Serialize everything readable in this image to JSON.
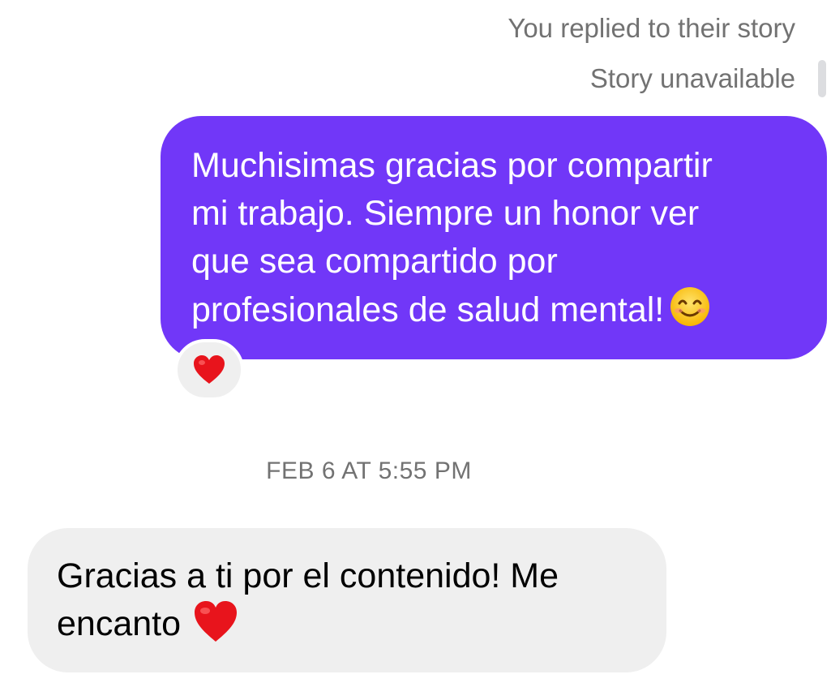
{
  "story_reply": {
    "label": "You replied to their story",
    "story_status": "Story unavailable"
  },
  "sent_message": {
    "lines": [
      "Muchisimas gracias por compartir",
      "mi trabajo. Siempre un honor ver",
      "que sea compartido por",
      "profesionales de salud mental!"
    ],
    "trailing_emoji": "smiling-face-emoji",
    "bubble_color": "#7137f8",
    "reaction": "red-heart-emoji"
  },
  "timestamp": "FEB 6 AT 5:55 PM",
  "received_message": {
    "lines": [
      "Gracias a ti por el contenido! Me",
      "encanto"
    ],
    "trailing_emoji": "red-heart-emoji",
    "bubble_color": "#efefef"
  }
}
